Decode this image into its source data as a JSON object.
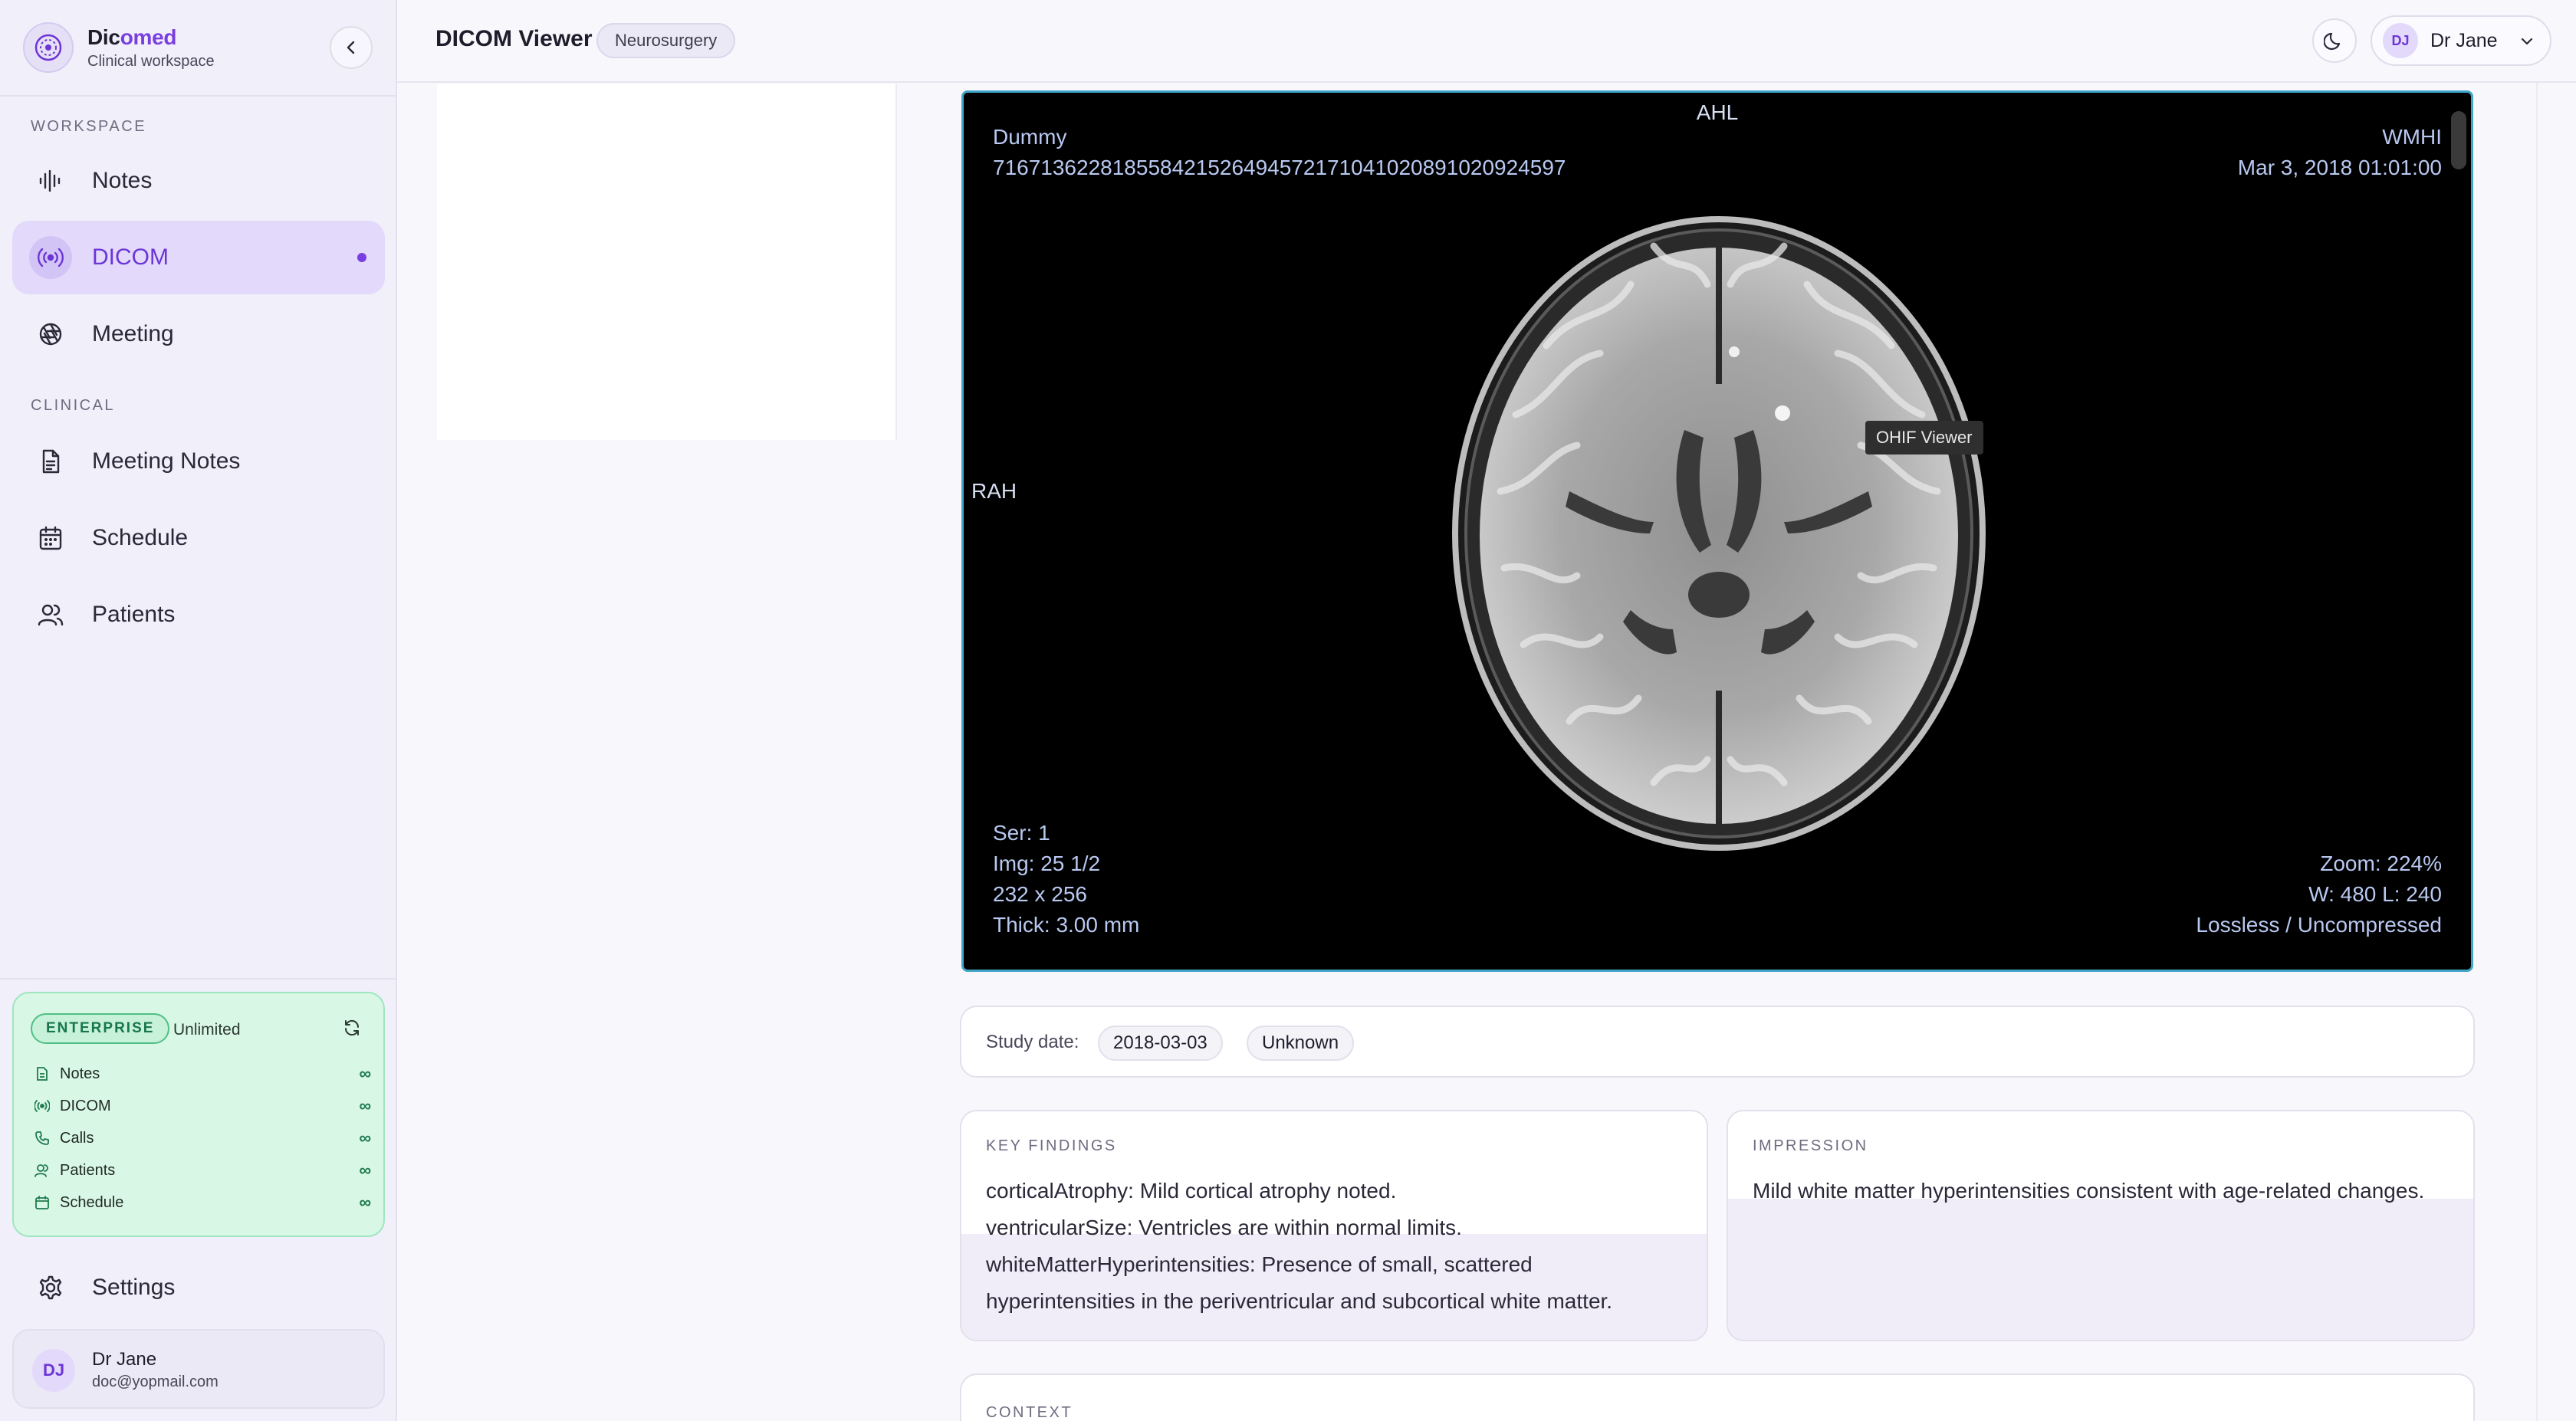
{
  "brand": {
    "name_part1": "Dic",
    "name_part2": "omed",
    "subtitle": "Clinical workspace"
  },
  "sidebar": {
    "workspace_label": "WORKSPACE",
    "clinical_label": "CLINICAL",
    "workspace_items": [
      {
        "label": "Notes",
        "icon": "waveform-icon"
      },
      {
        "label": "DICOM",
        "icon": "broadcast-icon",
        "active": true
      },
      {
        "label": "Meeting",
        "icon": "aperture-icon"
      }
    ],
    "clinical_items": [
      {
        "label": "Meeting Notes",
        "icon": "document-icon"
      },
      {
        "label": "Schedule",
        "icon": "calendar-icon"
      },
      {
        "label": "Patients",
        "icon": "users-icon"
      }
    ],
    "settings_label": "Settings"
  },
  "plan": {
    "badge": "ENTERPRISE",
    "tier": "Unlimited",
    "rows": [
      {
        "label": "Notes",
        "value": "∞"
      },
      {
        "label": "DICOM",
        "value": "∞"
      },
      {
        "label": "Calls",
        "value": "∞"
      },
      {
        "label": "Patients",
        "value": "∞"
      },
      {
        "label": "Schedule",
        "value": "∞"
      }
    ]
  },
  "user": {
    "initials": "DJ",
    "name": "Dr Jane",
    "email": "doc@yopmail.com"
  },
  "header": {
    "title": "DICOM Viewer",
    "department": "Neurosurgery"
  },
  "viewer": {
    "top_center": "AHL",
    "left_center": "RAH",
    "patient_name": "Dummy",
    "study_uid": "716713622818558421526494572171041020891020924597",
    "institution": "WMHI",
    "datetime": "Mar 3, 2018 01:01:00",
    "series": "Ser: 1",
    "image": "Img: 25 1/2",
    "dimensions": "232 x 256",
    "thickness": "Thick: 3.00 mm",
    "zoom": "Zoom: 224%",
    "window": "W: 480 L: 240",
    "compression": "Lossless / Uncompressed",
    "tooltip": "OHIF Viewer"
  },
  "study": {
    "label": "Study date:",
    "date": "2018-03-03",
    "status": "Unknown"
  },
  "findings": {
    "label": "KEY FINDINGS",
    "line1": "corticalAtrophy: Mild cortical atrophy noted.",
    "line2": "ventricularSize: Ventricles are within normal limits.",
    "line3": "whiteMatterHyperintensities: Presence of small, scattered",
    "line4": "hyperintensities in the periventricular and subcortical white matter."
  },
  "impression": {
    "label": "IMPRESSION",
    "text": "Mild white matter hyperintensities consistent with age-related changes."
  },
  "context": {
    "label": "CONTEXT"
  },
  "colors": {
    "accent": "#7a3fe0",
    "plan_bg": "#d9f7e5",
    "viewer_border": "#3fa6c9"
  }
}
